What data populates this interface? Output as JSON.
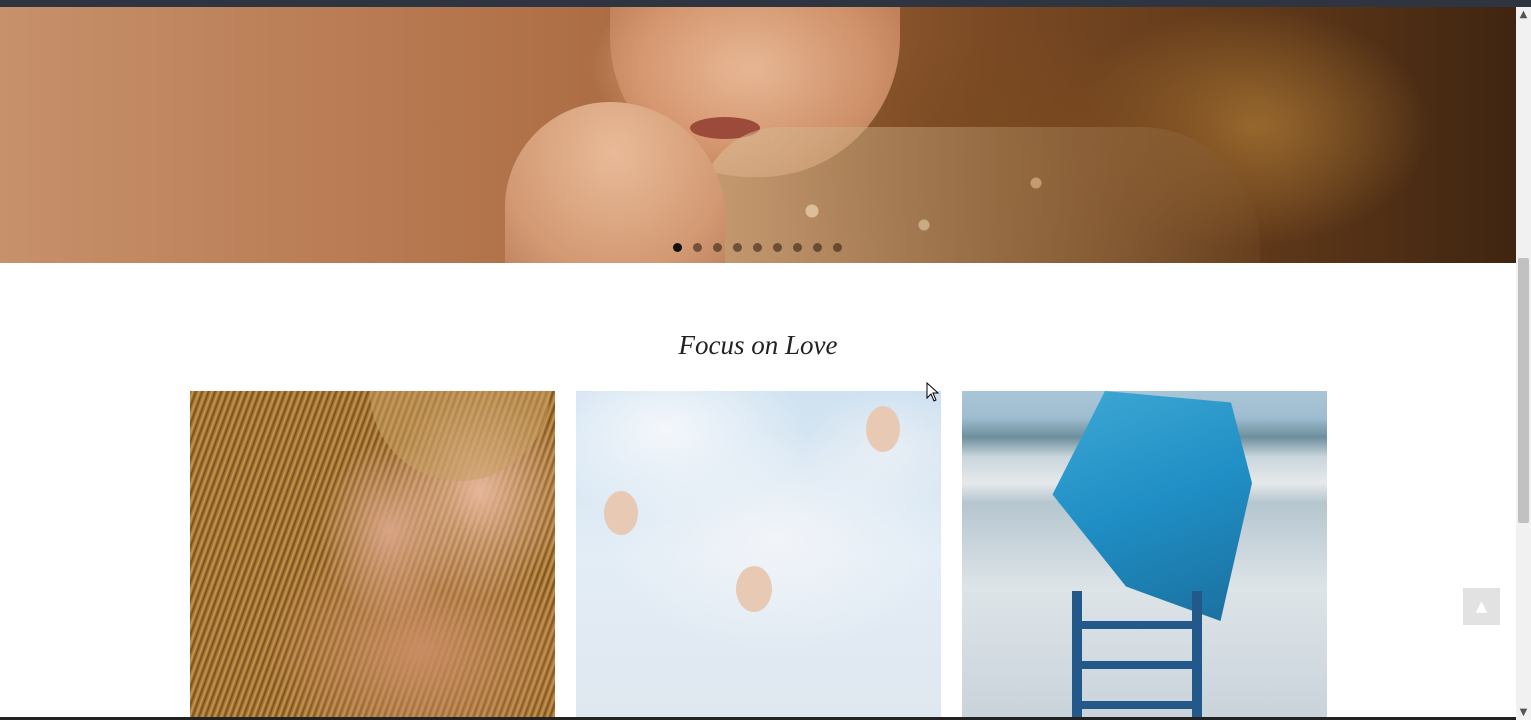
{
  "hero_slider": {
    "slide_count": 9,
    "active_index": 0
  },
  "section": {
    "title": "Focus on Love"
  },
  "gallery": {
    "items": [
      {
        "subject": "two women with golden headdresses"
      },
      {
        "subject": "women among white clouds"
      },
      {
        "subject": "figure with blue wings on ladder"
      }
    ]
  },
  "back_to_top": {
    "icon": "arrow-up-icon"
  }
}
